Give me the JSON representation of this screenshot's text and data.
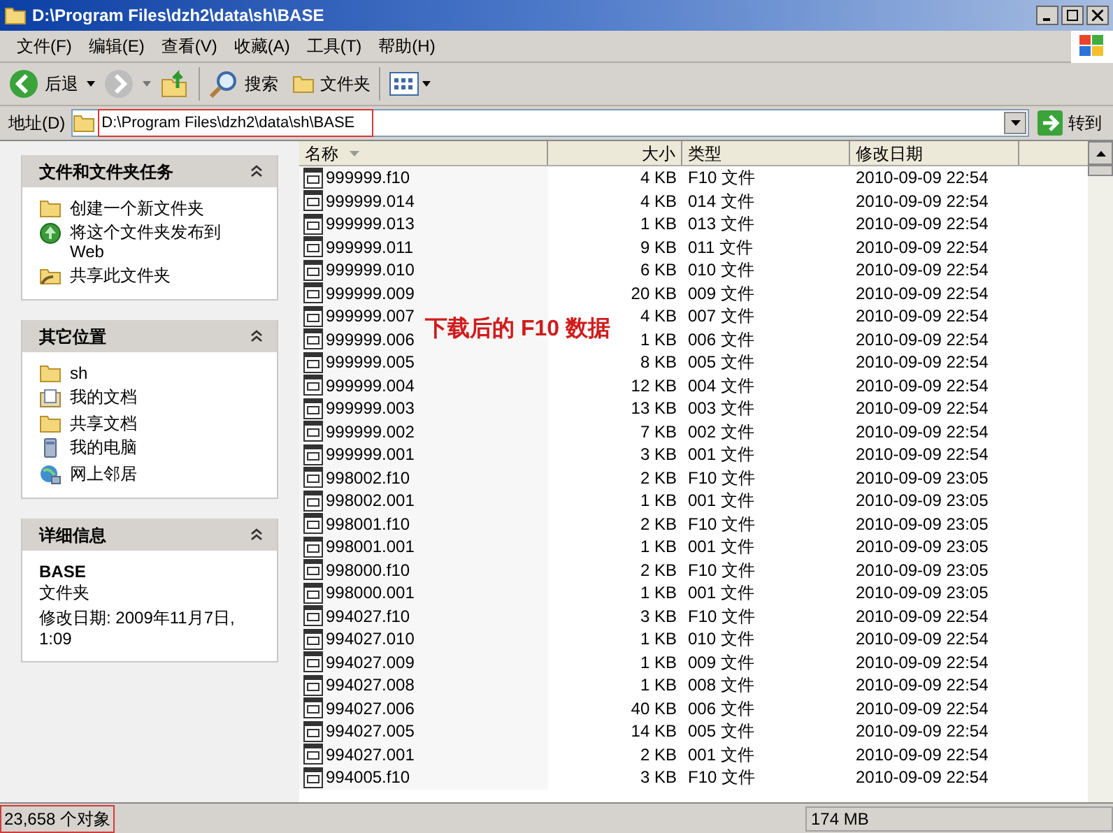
{
  "window": {
    "title": "D:\\Program Files\\dzh2\\data\\sh\\BASE"
  },
  "menu": [
    "文件(F)",
    "编辑(E)",
    "查看(V)",
    "收藏(A)",
    "工具(T)",
    "帮助(H)"
  ],
  "toolbar": {
    "back": "后退",
    "search": "搜索",
    "folders": "文件夹"
  },
  "address": {
    "label": "地址(D)",
    "value": "D:\\Program Files\\dzh2\\data\\sh\\BASE",
    "go": "转到"
  },
  "panels": [
    {
      "kind": "tasks",
      "title": "文件和文件夹任务",
      "expanded": true,
      "items": [
        "创建一个新文件夹",
        "将这个文件夹发布到 Web",
        "共享此文件夹"
      ]
    },
    {
      "kind": "places",
      "title": "其它位置",
      "expanded": true,
      "items": [
        "sh",
        "我的文档",
        "共享文档",
        "我的电脑",
        "网上邻居"
      ]
    },
    {
      "kind": "details",
      "title": "详细信息",
      "expanded": true,
      "name": "BASE",
      "type": "文件夹",
      "modified": "修改日期: 2009年11月7日, 1:09"
    }
  ],
  "table": {
    "columns": [
      "名称",
      "大小",
      "类型",
      "修改日期"
    ],
    "rows": [
      {
        "name": "999999.f10",
        "size": "4 KB",
        "type": "F10 文件",
        "date": "2010-09-09 22:54"
      },
      {
        "name": "999999.014",
        "size": "4 KB",
        "type": "014 文件",
        "date": "2010-09-09 22:54"
      },
      {
        "name": "999999.013",
        "size": "1 KB",
        "type": "013 文件",
        "date": "2010-09-09 22:54"
      },
      {
        "name": "999999.011",
        "size": "9 KB",
        "type": "011 文件",
        "date": "2010-09-09 22:54"
      },
      {
        "name": "999999.010",
        "size": "6 KB",
        "type": "010 文件",
        "date": "2010-09-09 22:54"
      },
      {
        "name": "999999.009",
        "size": "20 KB",
        "type": "009 文件",
        "date": "2010-09-09 22:54"
      },
      {
        "name": "999999.007",
        "size": "4 KB",
        "type": "007 文件",
        "date": "2010-09-09 22:54"
      },
      {
        "name": "999999.006",
        "size": "1 KB",
        "type": "006 文件",
        "date": "2010-09-09 22:54"
      },
      {
        "name": "999999.005",
        "size": "8 KB",
        "type": "005 文件",
        "date": "2010-09-09 22:54"
      },
      {
        "name": "999999.004",
        "size": "12 KB",
        "type": "004 文件",
        "date": "2010-09-09 22:54"
      },
      {
        "name": "999999.003",
        "size": "13 KB",
        "type": "003 文件",
        "date": "2010-09-09 22:54"
      },
      {
        "name": "999999.002",
        "size": "7 KB",
        "type": "002 文件",
        "date": "2010-09-09 22:54"
      },
      {
        "name": "999999.001",
        "size": "3 KB",
        "type": "001 文件",
        "date": "2010-09-09 22:54"
      },
      {
        "name": "998002.f10",
        "size": "2 KB",
        "type": "F10 文件",
        "date": "2010-09-09 23:05"
      },
      {
        "name": "998002.001",
        "size": "1 KB",
        "type": "001 文件",
        "date": "2010-09-09 23:05"
      },
      {
        "name": "998001.f10",
        "size": "2 KB",
        "type": "F10 文件",
        "date": "2010-09-09 23:05"
      },
      {
        "name": "998001.001",
        "size": "1 KB",
        "type": "001 文件",
        "date": "2010-09-09 23:05"
      },
      {
        "name": "998000.f10",
        "size": "2 KB",
        "type": "F10 文件",
        "date": "2010-09-09 23:05"
      },
      {
        "name": "998000.001",
        "size": "1 KB",
        "type": "001 文件",
        "date": "2010-09-09 23:05"
      },
      {
        "name": "994027.f10",
        "size": "3 KB",
        "type": "F10 文件",
        "date": "2010-09-09 22:54"
      },
      {
        "name": "994027.010",
        "size": "1 KB",
        "type": "010 文件",
        "date": "2010-09-09 22:54"
      },
      {
        "name": "994027.009",
        "size": "1 KB",
        "type": "009 文件",
        "date": "2010-09-09 22:54"
      },
      {
        "name": "994027.008",
        "size": "1 KB",
        "type": "008 文件",
        "date": "2010-09-09 22:54"
      },
      {
        "name": "994027.006",
        "size": "40 KB",
        "type": "006 文件",
        "date": "2010-09-09 22:54"
      },
      {
        "name": "994027.005",
        "size": "14 KB",
        "type": "005 文件",
        "date": "2010-09-09 22:54"
      },
      {
        "name": "994027.001",
        "size": "2 KB",
        "type": "001 文件",
        "date": "2010-09-09 22:54"
      },
      {
        "name": "994005.f10",
        "size": "3 KB",
        "type": "F10 文件",
        "date": "2010-09-09 22:54"
      }
    ]
  },
  "annotation": "下载后的 F10 数据",
  "status_bar": {
    "count": "23,658 个对象",
    "size": "174 MB"
  }
}
